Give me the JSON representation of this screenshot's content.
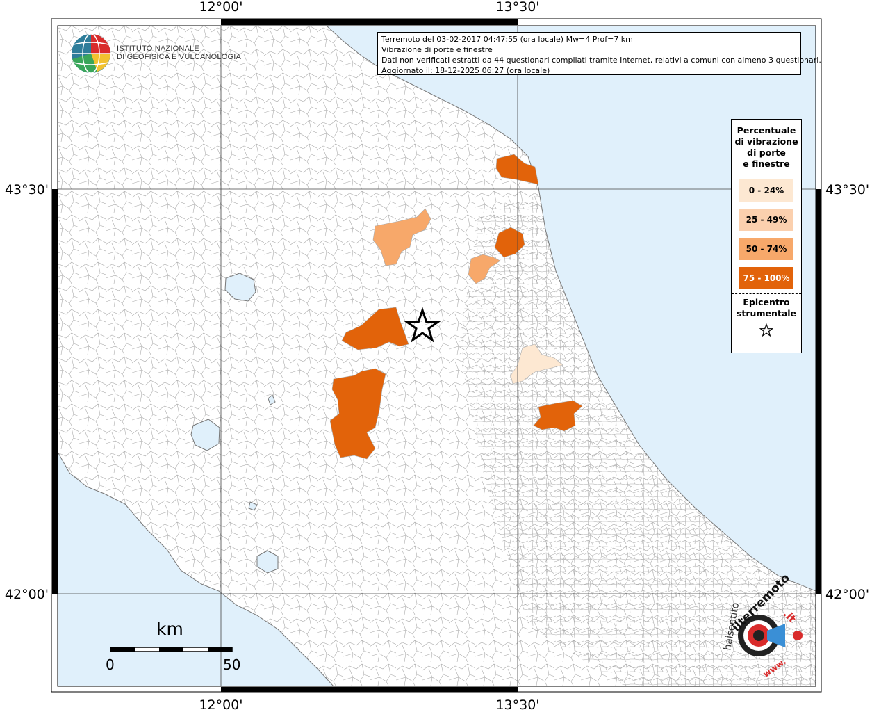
{
  "map": {
    "lon_labels": [
      "12°00'",
      "13°30'"
    ],
    "lat_labels": [
      "43°30'",
      "42°00'"
    ]
  },
  "info": {
    "line1": "Terremoto del 03-02-2017 04:47:55 (ora locale) Mw=4 Prof=7 km",
    "line2": "Vibrazione di porte e finestre",
    "line3": "Dati non verificati estratti da 44 questionari compilati tramite Internet, relativi a comuni con almeno 3 questionari.",
    "line4": "Aggiornato il: 18-12-2025 06:27 (ora locale)"
  },
  "institute": {
    "name_line1": "Istituto Nazionale",
    "name_line2": "di Geofisica e Vulcanologia"
  },
  "legend": {
    "title_lines": [
      "Percentuale",
      "di vibrazione",
      "di porte",
      "e finestre"
    ],
    "items": [
      {
        "label": "0 - 24%",
        "color": "#fde8d2"
      },
      {
        "label": "25 - 49%",
        "color": "#fbd0ae"
      },
      {
        "label": "50 - 74%",
        "color": "#f7a86a"
      },
      {
        "label": "75 - 100%",
        "color": "#e2630a"
      }
    ],
    "epicenter_lines": [
      "Epicentro",
      "strumentale"
    ]
  },
  "scale": {
    "unit": "km",
    "min": "0",
    "max": "50"
  },
  "watermark": {
    "text1": "haisentito",
    "text2": "ilterremoto",
    "text3": ".it",
    "text4": "www."
  },
  "colors": {
    "sea": "#e0f0fb",
    "land": "#ffffff",
    "borders": "#a9a9a9",
    "c0": "#fde8d2",
    "c25": "#fbd0ae",
    "c50": "#f7a86a",
    "c75": "#e2630a"
  }
}
